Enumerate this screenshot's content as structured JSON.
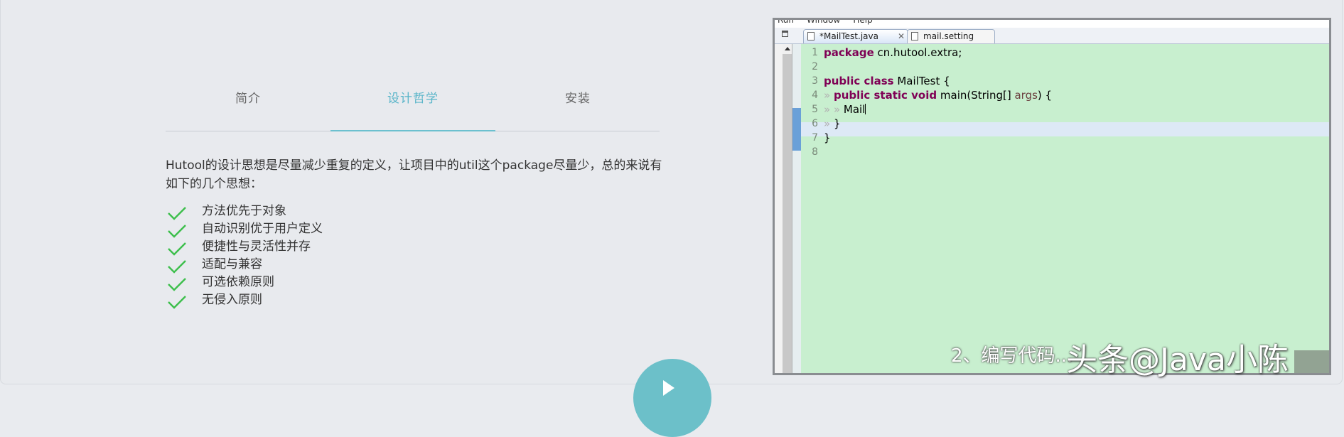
{
  "tabs": [
    {
      "label": "简介"
    },
    {
      "label": "设计哲学"
    },
    {
      "label": "安装"
    }
  ],
  "intro": "Hutool的设计思想是尽量减少重复的定义，让项目中的util这个package尽量少，总的来说有如下的几个思想：",
  "features": [
    "方法优先于对象",
    "自动识别优于用户定义",
    "便捷性与灵活性并存",
    "适配与兼容",
    "可选依赖原则",
    "无侵入原则"
  ],
  "colors": {
    "accent": "#5ab5c9",
    "check": "#3dbf4c",
    "editor_bg": "#c8efcf"
  },
  "ide": {
    "menu": [
      "Run",
      "Window",
      "Help"
    ],
    "editor_tabs": [
      {
        "label": "*MailTest.java",
        "active": true
      },
      {
        "label": "mail.setting",
        "active": false
      }
    ],
    "line_numbers": [
      "1",
      "2",
      "3",
      "4",
      "5",
      "6",
      "7",
      "8"
    ],
    "code": {
      "l1_kw": "package",
      "l1_rest": " cn.hutool.extra;",
      "l3_kw": "public class",
      "l3_rest": " MailTest {",
      "l4_kw": "public static void",
      "l4_rest": " main(String[] ",
      "l4_arg": "args",
      "l4_end": ") {",
      "l5": "Mail",
      "l6": "}",
      "l7": "}"
    }
  },
  "overlay": {
    "caption": "2、编写代码...",
    "watermark": "头条@Java小陈"
  }
}
